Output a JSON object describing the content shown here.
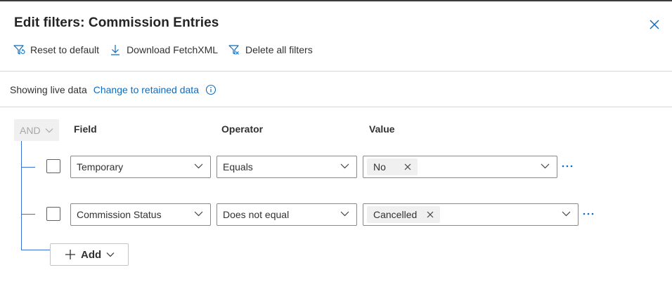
{
  "dialog": {
    "title": "Edit filters: Commission Entries"
  },
  "toolbar": {
    "reset_label": "Reset to default",
    "download_label": "Download FetchXML",
    "delete_label": "Delete all filters"
  },
  "data_mode": {
    "status": "Showing live data",
    "change_link": "Change to retained data"
  },
  "group": {
    "operator": "AND"
  },
  "columns": {
    "field": "Field",
    "operator": "Operator",
    "value": "Value"
  },
  "rows": [
    {
      "field": "Temporary",
      "operator": "Equals",
      "value": "No"
    },
    {
      "field": "Commission Status",
      "operator": "Does not equal",
      "value": "Cancelled"
    }
  ],
  "add": {
    "label": "Add"
  },
  "colors": {
    "link": "#0f6cbd",
    "tree_line": "#3a6fd8",
    "text": "#242424"
  }
}
